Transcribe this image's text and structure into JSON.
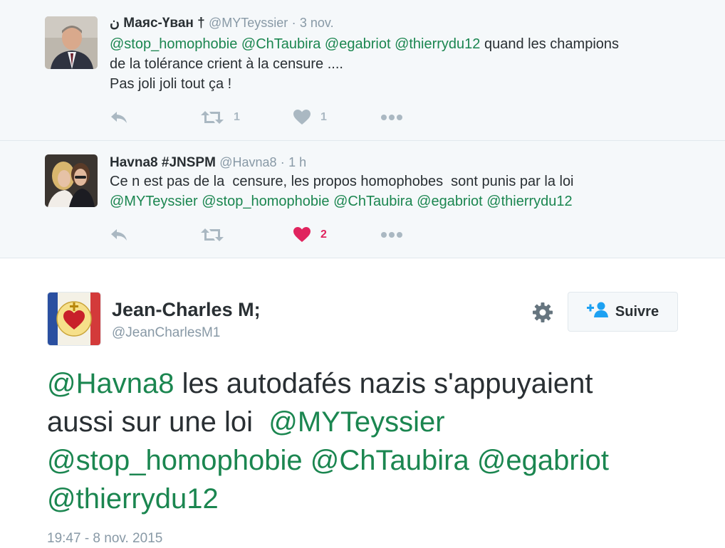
{
  "replies": [
    {
      "display_name": "ن Маяс-Үван †",
      "handle": "@MYTeyssier",
      "separator": "·",
      "time": "3 nov.",
      "lines": [
        [
          {
            "text": "@stop_homophobie",
            "mention": true
          },
          {
            "text": " ",
            "mention": false
          },
          {
            "text": "@ChTaubira",
            "mention": true
          },
          {
            "text": " ",
            "mention": false
          },
          {
            "text": "@egabriot",
            "mention": true
          },
          {
            "text": " ",
            "mention": false
          },
          {
            "text": "@thierrydu12",
            "mention": true
          },
          {
            "text": " quand les champions",
            "mention": false
          }
        ],
        [
          {
            "text": "de la tolérance crient à la censure ....",
            "mention": false
          }
        ],
        [
          {
            "text": "Pas joli joli tout ça !",
            "mention": false
          }
        ]
      ],
      "retweet_count": "1",
      "like_count": "1",
      "liked": false
    },
    {
      "display_name": "Havna8 #JNSPM",
      "handle": "@Havna8",
      "separator": "·",
      "time": "1 h",
      "lines": [
        [
          {
            "text": "Ce n est pas de la  censure, les propos homophobes  sont punis par la loi",
            "mention": false
          }
        ],
        [
          {
            "text": "@MYTeyssier",
            "mention": true
          },
          {
            "text": " ",
            "mention": false
          },
          {
            "text": "@stop_homophobie",
            "mention": true
          },
          {
            "text": " ",
            "mention": false
          },
          {
            "text": "@ChTaubira",
            "mention": true
          },
          {
            "text": " ",
            "mention": false
          },
          {
            "text": "@egabriot",
            "mention": true
          },
          {
            "text": " ",
            "mention": false
          },
          {
            "text": "@thierrydu12",
            "mention": true
          }
        ]
      ],
      "retweet_count": "",
      "like_count": "2",
      "liked": true
    }
  ],
  "main": {
    "display_name": "Jean-Charles M;",
    "handle": "@JeanCharlesM1",
    "follow_label": "Suivre",
    "lines": [
      [
        {
          "text": "@Havna8",
          "mention": true
        },
        {
          "text": " les autodafés nazis s'appuyaient",
          "mention": false
        }
      ],
      [
        {
          "text": "aussi sur une loi  ",
          "mention": false
        },
        {
          "text": "@MYTeyssier",
          "mention": true
        }
      ],
      [
        {
          "text": "@stop_homophobie",
          "mention": true
        },
        {
          "text": " ",
          "mention": false
        },
        {
          "text": "@ChTaubira",
          "mention": true
        },
        {
          "text": " ",
          "mention": false
        },
        {
          "text": "@egabriot",
          "mention": true
        }
      ],
      [
        {
          "text": "@thierrydu12",
          "mention": true
        }
      ]
    ],
    "timestamp": "19:47 - 8 nov. 2015"
  },
  "icons": {
    "reply": "reply-icon",
    "retweet": "retweet-icon",
    "like": "heart-icon",
    "more": "more-icon",
    "settings": "gear-icon",
    "follow": "add-user-icon"
  },
  "colors": {
    "mention": "#1b8650",
    "liked": "#e0245e",
    "action_idle": "#aab8c2",
    "thread_bg": "#f5f8fa"
  }
}
